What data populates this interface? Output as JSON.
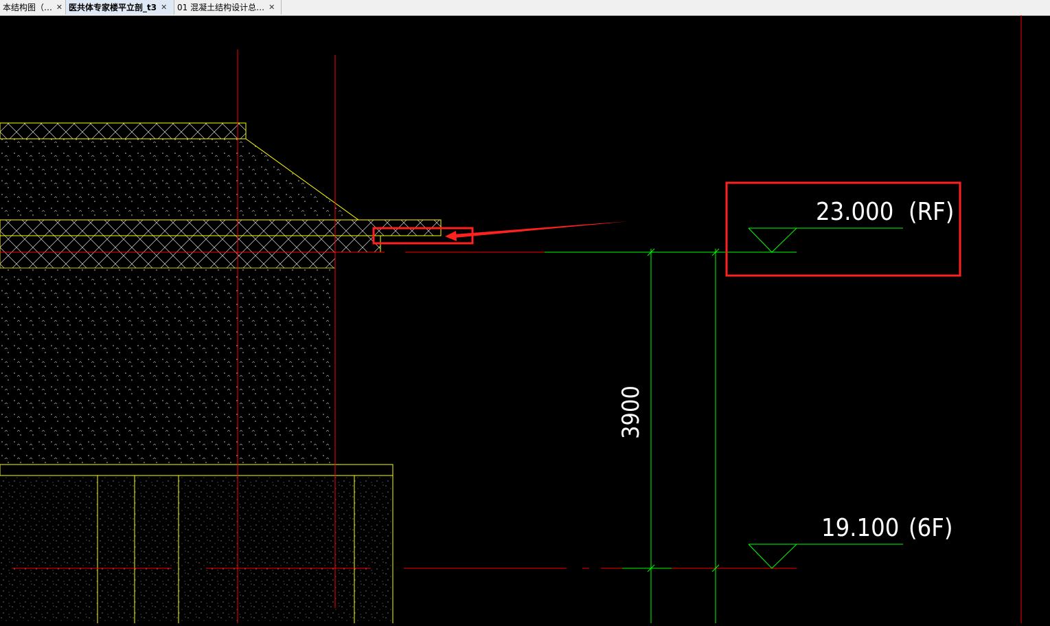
{
  "tabs": [
    {
      "label": "本结构图（…",
      "close": "✕",
      "active": false
    },
    {
      "label": "医共体专家楼平立剖_t3",
      "close": "✕",
      "active": true
    },
    {
      "label": "01 混凝土结构设计总…",
      "close": "✕",
      "active": false
    }
  ],
  "drawing": {
    "elevation_top": {
      "value": "23.000",
      "floor": "(RF)"
    },
    "elevation_bottom": {
      "value": "19.100",
      "floor": "(6F)"
    },
    "dimension": "3900"
  },
  "colors": {
    "background": "#000000",
    "axis_line": "#ff0000",
    "dimension_line": "#00ff00",
    "outline": "#ffff00",
    "annotation": "#ff2020",
    "text": "#ffffff"
  },
  "icons": [
    "close-icon",
    "arrow-pointer-icon",
    "elevation-marker-icon"
  ]
}
